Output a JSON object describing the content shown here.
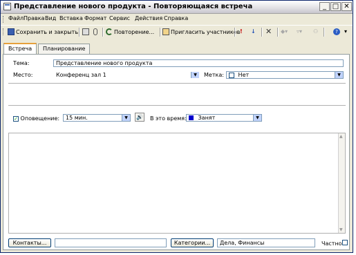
{
  "window": {
    "title": "Представление нового продукта - Повторяющаяся встреча"
  },
  "menu": [
    "Файл",
    "Правка",
    "Вид",
    "Вставка",
    "Формат",
    "Сервис",
    "Действия",
    "Справка"
  ],
  "toolbar": {
    "save_close": "Сохранить и закрыть",
    "recurrence": "Повторение...",
    "invite": "Пригласить участников"
  },
  "tabs": [
    "Встреча",
    "Планирование"
  ],
  "form": {
    "subject_label": "Тема:",
    "subject_value": "Представление нового продукта",
    "location_label": "Место:",
    "location_value": "Конференц зал 1",
    "label_label": "Метка:",
    "label_value": "Нет",
    "reminder_label": "Оповещение:",
    "reminder_value": "15 мин.",
    "showas_label": "В это время:",
    "showas_value": "Занят",
    "showas_color": "#0000cc"
  },
  "footer": {
    "contacts_button": "Контакты...",
    "contacts_value": "",
    "categories_button": "Категории...",
    "categories_value": "Дела, Финансы",
    "private_label": "Частное"
  }
}
